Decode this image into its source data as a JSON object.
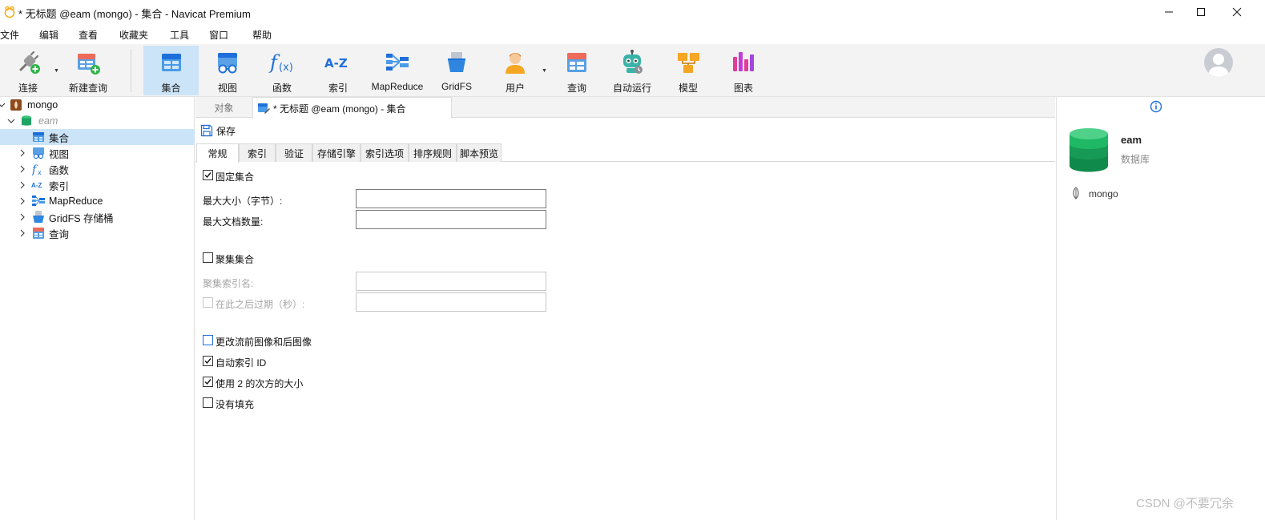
{
  "window": {
    "title": "* 无标题 @eam (mongo) - 集合 - Navicat Premium"
  },
  "menu": [
    "文件",
    "编辑",
    "查看",
    "收藏夹",
    "工具",
    "窗口",
    "帮助"
  ],
  "toolbar": {
    "items": [
      {
        "label": "连接",
        "icon": "plug-icon"
      },
      {
        "label": "新建查询",
        "icon": "new-query-icon"
      },
      {
        "label": "集合",
        "icon": "collection-icon",
        "active": true
      },
      {
        "label": "视图",
        "icon": "view-icon"
      },
      {
        "label": "函数",
        "icon": "function-icon"
      },
      {
        "label": "索引",
        "icon": "index-icon"
      },
      {
        "label": "MapReduce",
        "icon": "mapreduce-icon"
      },
      {
        "label": "GridFS",
        "icon": "gridfs-icon"
      },
      {
        "label": "用户",
        "icon": "user-icon"
      },
      {
        "label": "查询",
        "icon": "query-icon"
      },
      {
        "label": "自动运行",
        "icon": "robot-icon"
      },
      {
        "label": "模型",
        "icon": "model-icon"
      },
      {
        "label": "图表",
        "icon": "chart-icon"
      }
    ]
  },
  "nav": {
    "connection": "mongo",
    "database": "eam",
    "items": [
      {
        "label": "集合",
        "icon": "collection-icon",
        "selected": true
      },
      {
        "label": "视图",
        "icon": "view-icon"
      },
      {
        "label": "函数",
        "icon": "function-icon"
      },
      {
        "label": "索引",
        "icon": "index-icon",
        "prefix": "A-Z"
      },
      {
        "label": "MapReduce",
        "icon": "mapreduce-icon"
      },
      {
        "label": "GridFS 存储桶",
        "icon": "gridfs-icon"
      },
      {
        "label": "查询",
        "icon": "query-icon"
      }
    ]
  },
  "tabs": {
    "objects": "对象",
    "active": "* 无标题 @eam (mongo) - 集合"
  },
  "save_label": "保存",
  "subtabs": [
    "常规",
    "索引",
    "验证",
    "存储引擎",
    "索引选项",
    "排序规则",
    "脚本预览"
  ],
  "form": {
    "capped": {
      "label": "固定集合",
      "checked": true
    },
    "max_size_label": "最大大小（字节）:",
    "max_size_value": "",
    "max_docs_label": "最大文档数量:",
    "max_docs_value": "",
    "clustered": {
      "label": "聚集集合",
      "checked": false
    },
    "cluster_index_label": "聚集索引名:",
    "cluster_index_value": "",
    "expire_label": "在此之后过期（秒）:",
    "expire_value": "",
    "change_stream": {
      "label": "更改流前图像和后图像",
      "checked": false
    },
    "auto_index": {
      "label": "自动索引 ID",
      "checked": true
    },
    "power_of_2": {
      "label": "使用 2 的次方的大小",
      "checked": true
    },
    "no_padding": {
      "label": "没有填充",
      "checked": false
    }
  },
  "right_panel": {
    "db_name": "eam",
    "db_type": "数据库",
    "connection": "mongo"
  },
  "watermark": "CSDN @不要冗余",
  "colors": {
    "accent": "#1e6fd9",
    "selected_bg": "#cce4f7",
    "db_green": "#1fa463"
  }
}
